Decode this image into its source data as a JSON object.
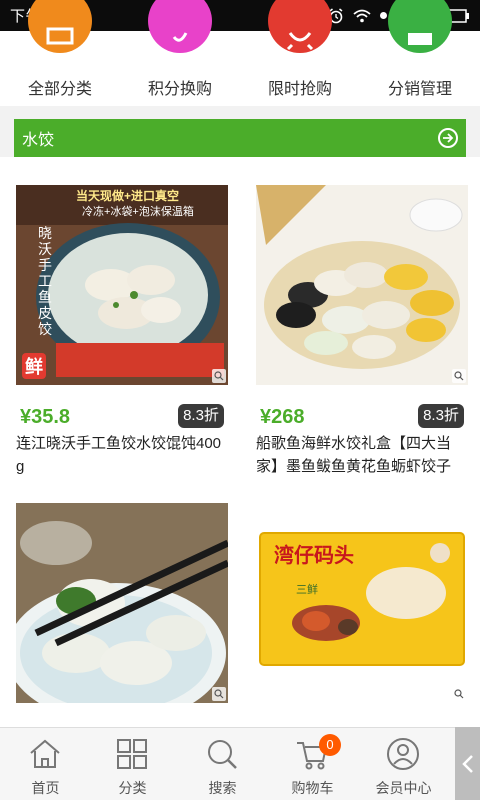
{
  "status_bar": {
    "time": "下午5:12"
  },
  "categories": [
    {
      "label": "全部分类",
      "icon": "grid-icon",
      "color": "#f08a1c"
    },
    {
      "label": "积分换购",
      "icon": "points-icon",
      "color": "#e842c9"
    },
    {
      "label": "限时抢购",
      "icon": "alarm-clock-icon",
      "color": "#e23a30"
    },
    {
      "label": "分销管理",
      "icon": "distribution-icon",
      "color": "#3ab043"
    }
  ],
  "section": {
    "title": "水饺",
    "accent": "#4bad2a"
  },
  "products": [
    {
      "price": "¥35.8",
      "discount": "8.3折",
      "name": "连江晓沃手工鱼饺水饺馄饨400g",
      "image_texts": [
        "当天现做+进口真空",
        "冷冻+冰袋+泡沫保温箱",
        "晓沃手工鱼皮饺",
        "鲜"
      ]
    },
    {
      "price": "¥268",
      "discount": "8.3折",
      "name": "船歌鱼海鲜水饺礼盒【四大当家】墨鱼鲅鱼黄花鱼蛎虾饺子",
      "image_texts": []
    },
    {
      "price": "",
      "discount": "",
      "name": "",
      "image_texts": []
    },
    {
      "price": "",
      "discount": "",
      "name": "",
      "image_texts": [
        "湾仔码头",
        "三鲜"
      ]
    }
  ],
  "bottom_nav": [
    {
      "label": "首页",
      "icon": "home-icon"
    },
    {
      "label": "分类",
      "icon": "category-icon"
    },
    {
      "label": "搜索",
      "icon": "search-icon"
    },
    {
      "label": "购物车",
      "icon": "cart-icon",
      "badge": "0"
    },
    {
      "label": "会员中心",
      "icon": "user-icon"
    }
  ],
  "colors": {
    "price_green": "#4bad2a",
    "discount_bg": "#3a3a3a",
    "badge_orange": "#ff5a00"
  }
}
